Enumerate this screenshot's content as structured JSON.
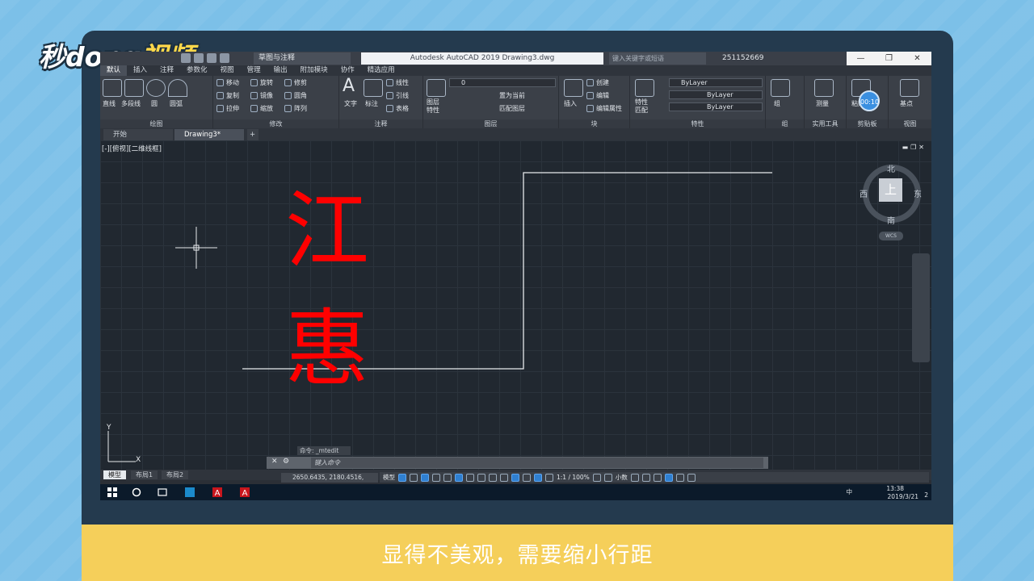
{
  "branding": {
    "logo_main": "秒dong",
    "logo_sub": "视频"
  },
  "caption": "显得不美观，需要缩小行距",
  "window": {
    "title": "Autodesk AutoCAD 2019    Drawing3.dwg",
    "workspace": "草图与注释",
    "search_placeholder": "键入关键字或短语",
    "user_id": "251152669",
    "minimize": "—",
    "restore": "❐",
    "close": "✕"
  },
  "menu": {
    "tabs": [
      "默认",
      "插入",
      "注释",
      "参数化",
      "视图",
      "管理",
      "输出",
      "附加模块",
      "协作",
      "精选应用"
    ]
  },
  "ribbon": {
    "draw": {
      "title": "绘图",
      "line": "直线",
      "polyline": "多段线",
      "circle": "圆",
      "arc": "圆弧"
    },
    "modify": {
      "title": "修改",
      "move": "移动",
      "rotate": "旋转",
      "trim": "修剪",
      "copy": "复制",
      "mirror": "镜像",
      "fillet": "圆角",
      "stretch": "拉伸",
      "scale": "缩放",
      "array": "阵列"
    },
    "annotation": {
      "title": "注释",
      "text": "文字",
      "dimension": "标注",
      "linear": "线性",
      "leader": "引线",
      "table": "表格"
    },
    "layers": {
      "title": "图层",
      "layer_props": "图层",
      "layer_props2": "特性",
      "current_layer": "0",
      "make_current": "置为当前",
      "match_layer": "匹配图层"
    },
    "block": {
      "title": "块",
      "insert": "插入",
      "create": "创建",
      "edit": "编辑",
      "edit_attr": "编辑属性"
    },
    "properties": {
      "title": "特性",
      "match": "特性",
      "match2": "匹配",
      "color": "ByLayer",
      "linetype": "ByLayer",
      "lineweight": "ByLayer"
    },
    "group": {
      "title": "组",
      "group": "组"
    },
    "utilities": {
      "title": "实用工具",
      "measure": "测量"
    },
    "clipboard": {
      "title": "剪贴板",
      "paste": "粘贴"
    },
    "view": {
      "title": "视图",
      "base": "基点"
    }
  },
  "doc_tabs": [
    "开始",
    "Drawing3*"
  ],
  "canvas": {
    "view_label": "[-][俯视][二维线框]",
    "text_chars": [
      "江",
      "惠"
    ],
    "compass": {
      "north": "北",
      "south": "南",
      "east": "东",
      "west": "西",
      "top": "上"
    },
    "wcs": "WCS",
    "timer": "00:10"
  },
  "command": {
    "history": "命令: _mtedit",
    "placeholder": "键入命令"
  },
  "layout_tabs": [
    "模型",
    "布局1",
    "布局2"
  ],
  "status": {
    "coords": "2650.6435, 2180.4516, 0.0000",
    "model": "模型",
    "scale": "1:1 / 100%",
    "units": "小数"
  },
  "taskbar": {
    "time": "13:38",
    "date": "2019/3/21",
    "ime": "中",
    "notify_count": "2"
  }
}
